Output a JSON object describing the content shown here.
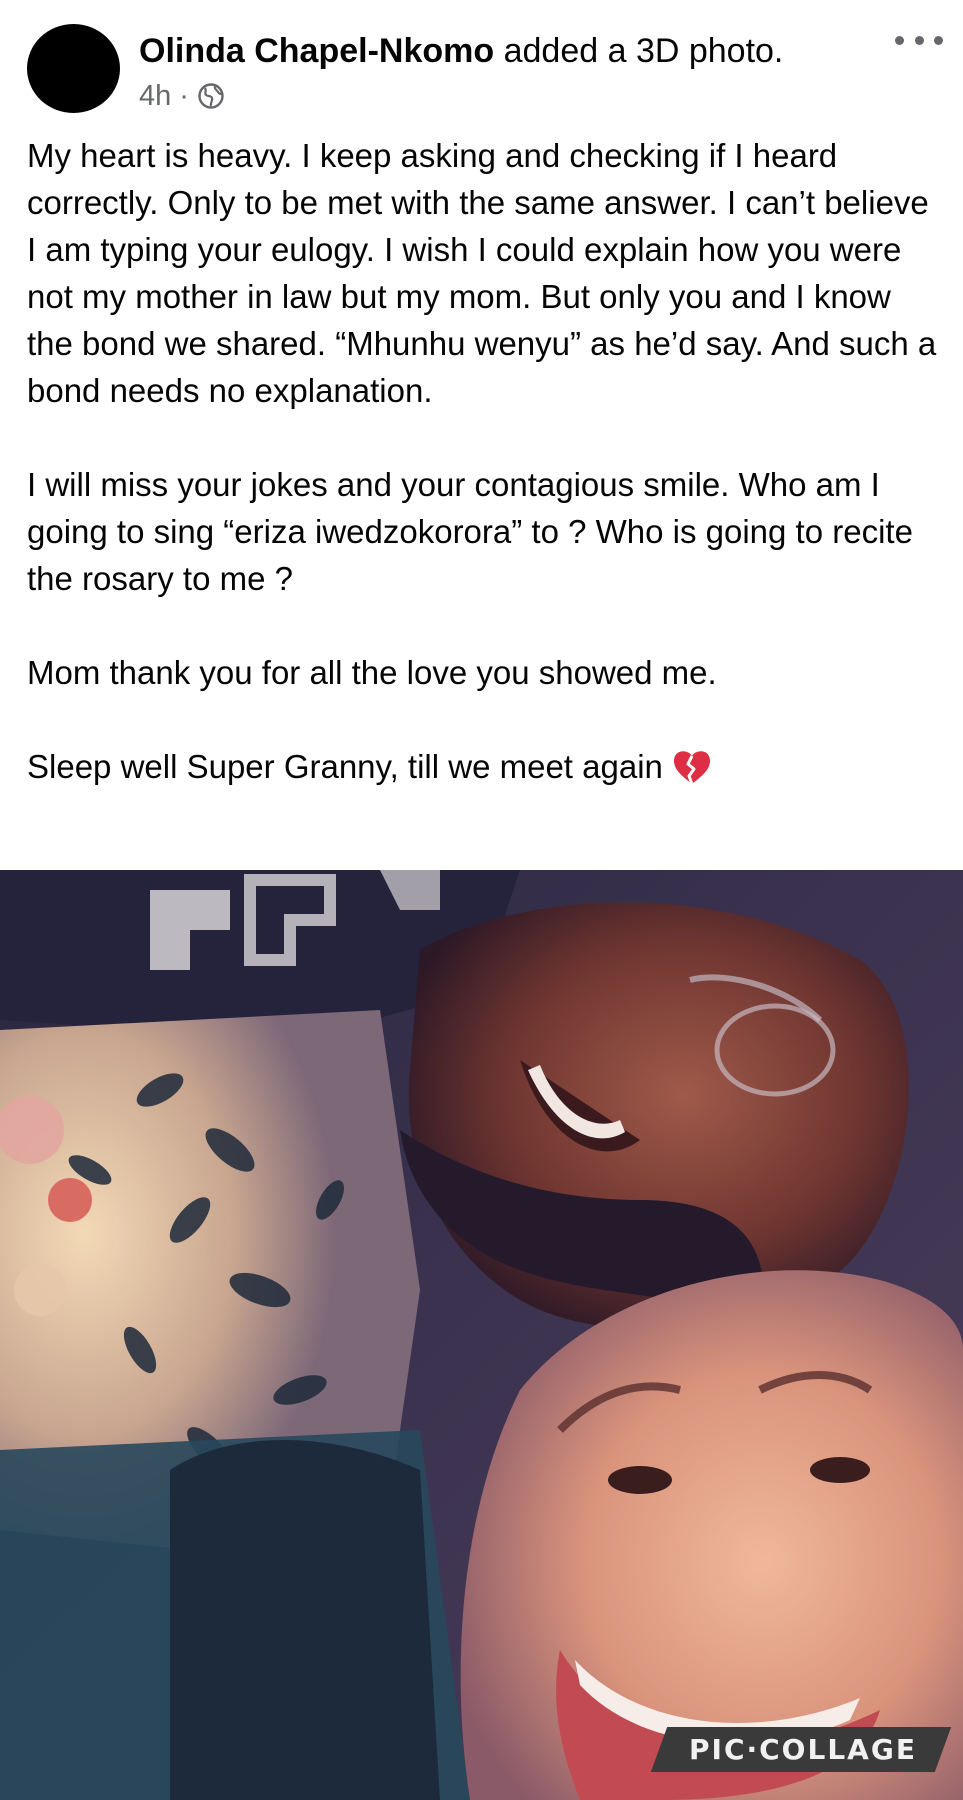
{
  "post": {
    "author": "Olinda Chapel-Nkomo",
    "action": "added a 3D photo.",
    "timestamp": "4h",
    "separator": "·",
    "privacy_icon": "globe-icon",
    "more_icon": "more-dots-icon"
  },
  "body": {
    "paragraphs": [
      "My heart is heavy. I keep asking and checking if I heard correctly. Only to be met with the same answer. I can’t believe I am typing your eulogy. I wish I could explain how you were not my mother in law but my mom. But only you and I know the bond we shared. “Mhunhu wenyu” as he’d say. And such a bond needs no explanation.",
      "I will miss your jokes and your contagious smile. Who am I going to sing “eriza iwedzokorora” to ? Who is going to recite the rosary to me ?",
      "Mom thank you for all the love you showed me.",
      "Sleep well Super Granny, till we meet again"
    ],
    "end_emoji": "broken-heart-icon"
  },
  "photo": {
    "watermark": "PIC·COLLAGE"
  }
}
